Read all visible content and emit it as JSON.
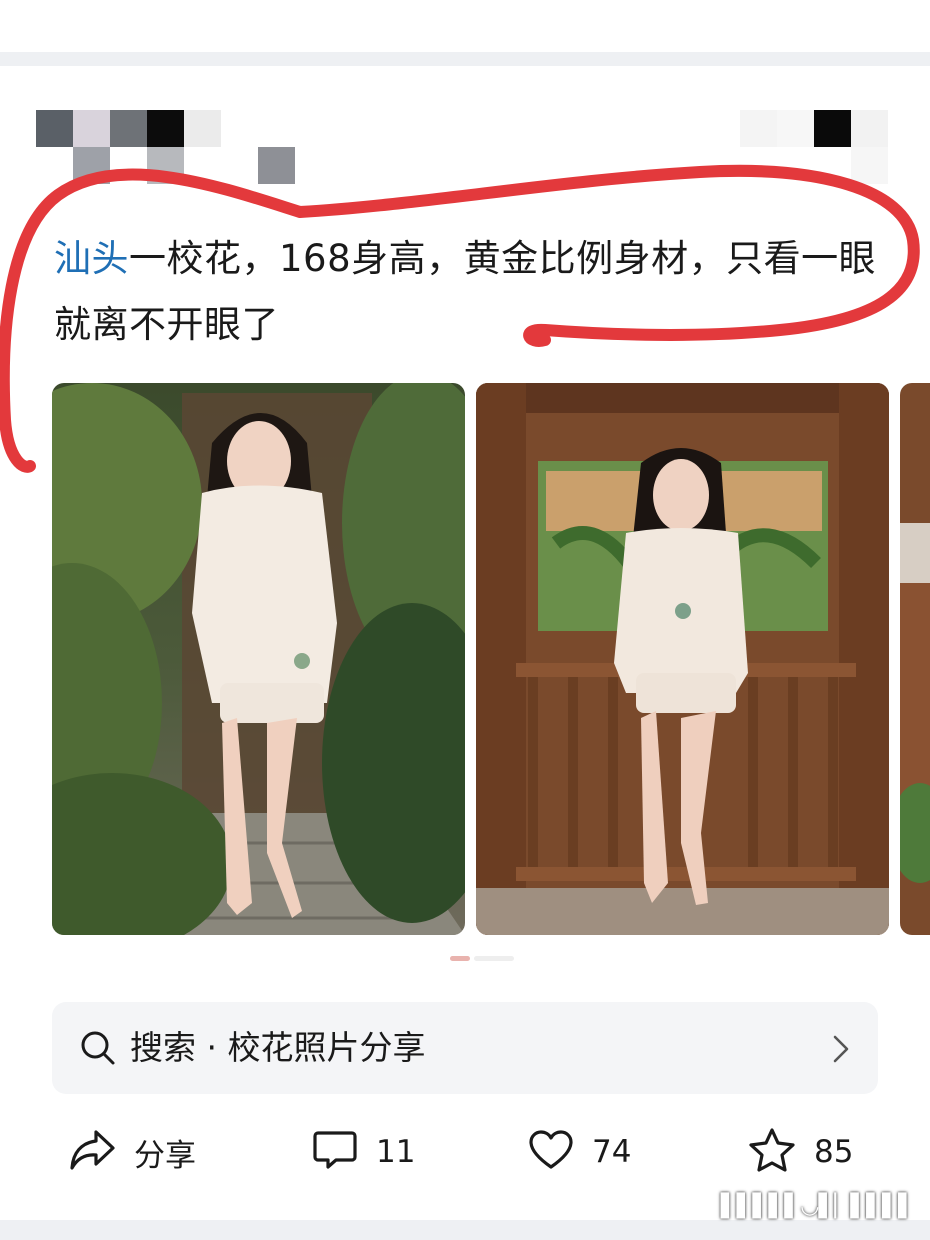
{
  "post": {
    "topic": "汕头",
    "text": "一校花，168身高，黄金比例身材，只看一眼就离不开眼了"
  },
  "images": [
    {
      "alt": "photo-garden"
    },
    {
      "alt": "photo-pavilion"
    },
    {
      "alt": "photo-partial"
    }
  ],
  "search": {
    "prefix": "搜索",
    "dot": "·",
    "query": "校花照片分享"
  },
  "actions": {
    "share_label": "分享",
    "comment_count": "11",
    "like_count": "74",
    "favorite_count": "85"
  },
  "icons": [
    "search-icon",
    "chevron-right-icon",
    "share-icon",
    "comment-icon",
    "heart-icon",
    "star-icon"
  ],
  "colors": {
    "topic_link": "#1f6fb5",
    "annotation_red": "#e3393c",
    "search_bg": "#f4f5f7"
  }
}
